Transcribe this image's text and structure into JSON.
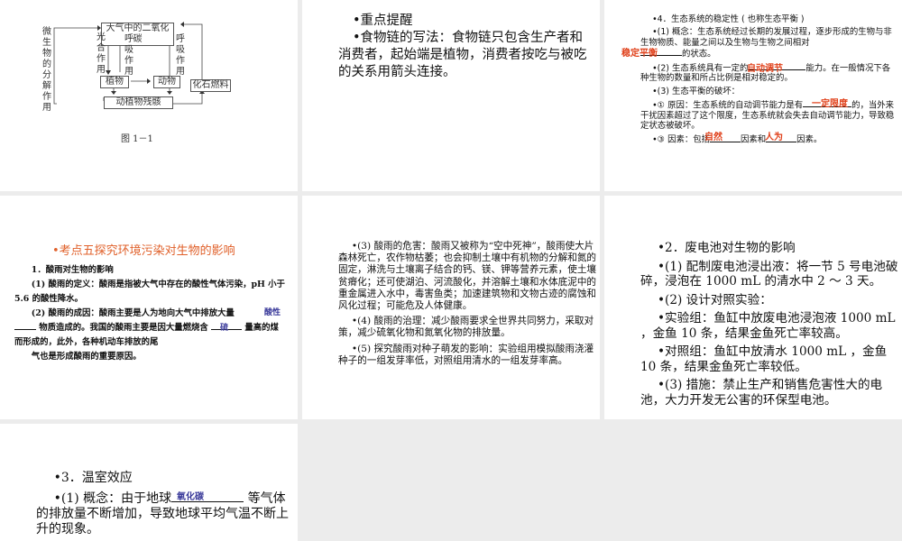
{
  "slide1": {
    "top_box": "大气中的二氧化碳",
    "plant": "植物",
    "animal": "动物",
    "fossil": "化石燃料",
    "remains": "动植物残骸",
    "microbe": "微生物的分解作用",
    "photo": "光合作用",
    "resp1": "呼吸作用",
    "resp2": "呼吸作用",
    "caption": "图 1－1"
  },
  "slide2": {
    "p1": "•重点提醒",
    "p2": "•食物链的写法：食物链只包含生产者和消费者，起始端是植物，消费者按吃与被吃的关系用箭头连接。"
  },
  "slide3": {
    "h": "•4．生态系统的稳定性 ( 也称生态平衡 )",
    "p1a": "•(1) 概念：生态系统经过长期的发展过程，逐步形成的生物与非生物物质、能量之间以及生物与生物之间相对",
    "p1b": "的状态。",
    "a1": "稳定平衡",
    "p2a": "•(2) 生态系统具有一定的",
    "p2b": "能力。在一般情况下各种生物的数量和所占比例是相对稳定的。",
    "a2": "自动调节",
    "p3": "•(3) 生态平衡的破坏：",
    "p4a": "•① 原因：生态系统的自动调节能力是有",
    "p4b": "的，当外来干扰因素超过了这个限度，生态系统就会失去自动调节能力，导致稳定状态被破坏。",
    "a3": "一定限度",
    "p5a": "•③ 因素：包括",
    "p5b": "因素和",
    "p5c": "因素。",
    "a4": "自然",
    "a5": "人为"
  },
  "slide4": {
    "title": "•考点五探究环境污染对生物的影响",
    "h": "1．酸雨对生物的影响",
    "p1": "(1) 酸雨的定义：酸雨是指被大气中存在的酸性气体污染，pH 小于 5.6 的酸性降水。",
    "p2a": "(2) 酸雨的成因：酸雨主要是人为地向大气中排放大量",
    "p2b": "物质造成的。我国的酸雨主要是因大量燃烧含",
    "p2c": "量高的煤而形成的，此外，各种机动车排放的尾",
    "p3": "气也是形成酸雨的重要原因。",
    "a1": "酸性",
    "a2": "硫"
  },
  "slide5": {
    "p1": "•(3) 酸雨的危害：酸雨又被称为“空中死神”，酸雨使大片森林死亡，农作物枯萎；也会抑制土壤中有机物的分解和氮的固定，淋洗与土壤离子结合的钙、镁、钾等营养元素，使土壤贫瘠化；还可使湖泊、河流酸化，并溶解土壤和水体底泥中的重金属进入水中，毒害鱼类；加速建筑物和文物古迹的腐蚀和风化过程；可能危及人体健康。",
    "p2": "•(4) 酸雨的治理：减少酸雨要求全世界共同努力，采取对策，减少硫氧化物和氮氧化物的排放量。",
    "p3": "•(5) 探究酸雨对种子萌发的影响：实验组用模拟酸雨浇灌种子的一组发芽率低，对照组用清水的一组发芽率高。"
  },
  "slide6": {
    "h": "•2．废电池对生物的影响",
    "p1": "•(1) 配制废电池浸出液：将一节 5 号电池破碎，浸泡在 1000 mL 的清水中 2 ～ 3 天。",
    "p2": "•(2) 设计对照实验：",
    "p3": "•实验组：鱼缸中放废电池浸泡液 1000 mL ，金鱼 10 条，结果金鱼死亡率较高。",
    "p4": "•对照组：鱼缸中放清水 1000 mL ，金鱼 10 条，结果金鱼死亡率较低。",
    "p5": "•(3) 措施：禁止生产和销售危害性大的电池，大力开发无公害的环保型电池。"
  },
  "slide7": {
    "h": "•3．温室效应",
    "p1a": "•(1) 概念：由于地球",
    "p1b": "等气体的排放量不断增加，导致地球平均气温不断上升的现象。",
    "a1": "氧化碳"
  }
}
